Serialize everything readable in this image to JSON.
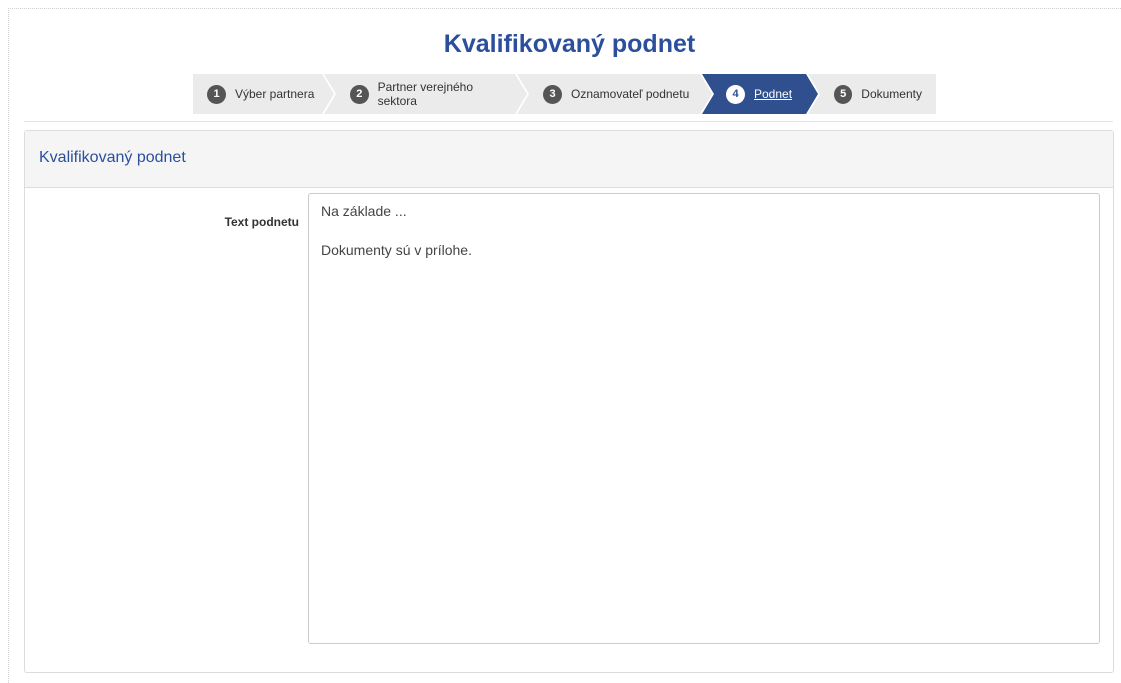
{
  "page": {
    "title": "Kvalifikovaný podnet"
  },
  "wizard": {
    "steps": [
      {
        "num": "1",
        "label": "Výber partnera",
        "state": "done"
      },
      {
        "num": "2",
        "label": "Partner verejného sektora",
        "state": "done"
      },
      {
        "num": "3",
        "label": "Oznamovateľ podnetu",
        "state": "done"
      },
      {
        "num": "4",
        "label": "Podnet",
        "state": "active"
      },
      {
        "num": "5",
        "label": "Dokumenty",
        "state": "todo"
      }
    ]
  },
  "panel": {
    "title": "Kvalifikovaný podnet",
    "field_label": "Text podnetu",
    "text_lines": [
      "Na základe ...",
      "Dokumenty sú v prílohe."
    ]
  },
  "colors": {
    "accent": "#2b4f9c",
    "active_step": "#2f4f8f",
    "step_bg": "#ebebeb"
  }
}
